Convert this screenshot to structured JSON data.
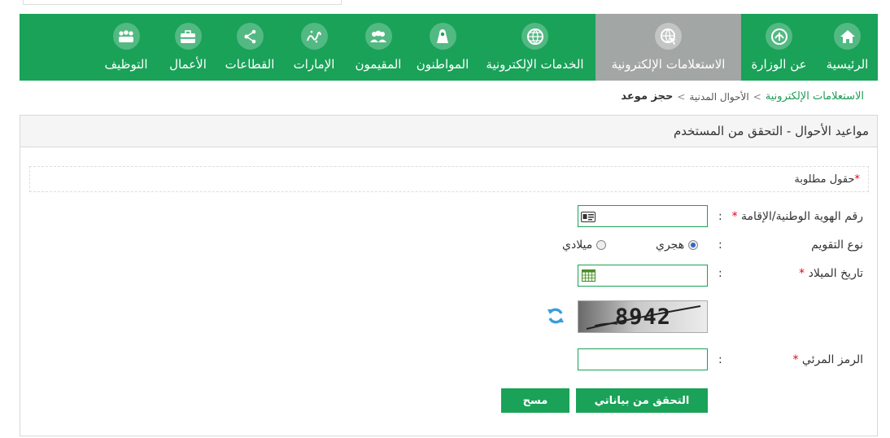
{
  "nav": {
    "items": [
      {
        "label": "الرئيسية",
        "icon": "home-icon"
      },
      {
        "label": "عن الوزارة",
        "icon": "ministry-emblem-icon"
      },
      {
        "label": "الاستعلامات الإلكترونية",
        "icon": "globe-cursor-icon",
        "active": true
      },
      {
        "label": "الخدمات الإلكترونية",
        "icon": "globe-icon"
      },
      {
        "label": "المواطنون",
        "icon": "citizen-icon"
      },
      {
        "label": "المقيمون",
        "icon": "group-icon"
      },
      {
        "label": "الإمارات",
        "icon": "calligraphy-icon"
      },
      {
        "label": "القطاعات",
        "icon": "network-icon"
      },
      {
        "label": "الأعمال",
        "icon": "briefcase-icon"
      },
      {
        "label": "التوظيف",
        "icon": "people-icon"
      }
    ]
  },
  "breadcrumb": {
    "root": "الاستعلامات الإلكترونية",
    "middle": "الأحوال المدنية",
    "current": "حجز موعد",
    "separator": ">"
  },
  "panel": {
    "title": "مواعيد الأحوال - التحقق من المستخدم",
    "required_note": "حقول مطلوبة",
    "required_mark": "*"
  },
  "form": {
    "colon": ":",
    "id_label": "رقم الهوية الوطنية/الإقامة",
    "id_value": "",
    "calendar_label": "نوع التقويم",
    "calendar_options": [
      "هجري",
      "ميلادي"
    ],
    "calendar_selected": "هجري",
    "birthdate_label": "تاريخ الميلاد",
    "birthdate_value": "",
    "captcha_text": "8942",
    "visual_code_label": "الرمز المرئي",
    "visual_code_value": "",
    "verify_button": "التحقق من بياناتي",
    "clear_button": "مسح"
  },
  "colors": {
    "brand_green": "#1aa259",
    "active_gray": "#a2a6a4",
    "required_red": "#e2001a",
    "link_green": "#1a9d55"
  }
}
